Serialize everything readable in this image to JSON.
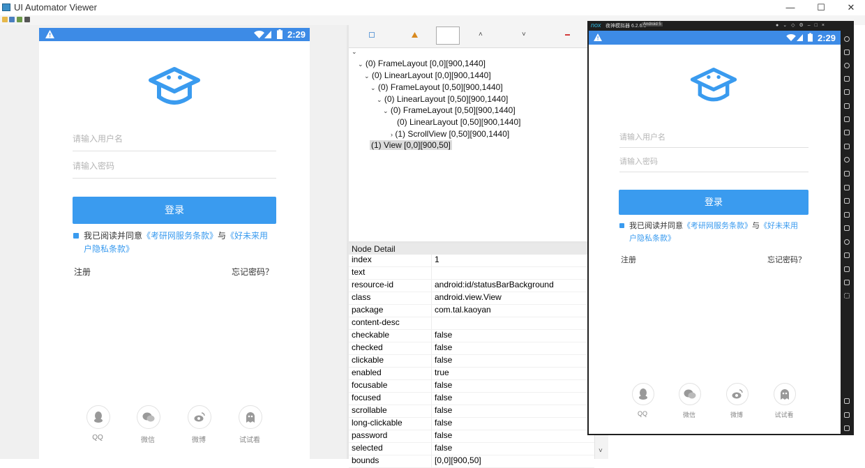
{
  "window": {
    "title": "UI Automator Viewer",
    "controls": {
      "minimize": "—",
      "maximize": "☐",
      "close": "✕"
    }
  },
  "toolbar": {
    "icons": [
      "open-icon",
      "device-screenshot-icon",
      "compressed-screenshot-icon",
      "save-icon"
    ]
  },
  "device_left": {
    "status_time": "2:29",
    "username_placeholder": "请输入用户名",
    "password_placeholder": "请输入密码",
    "login_label": "登录",
    "agree_prefix": "我已阅读并同意",
    "agree_link1": "《考研网服务条款》",
    "agree_and": "与",
    "agree_link2_line1": "《好未来用",
    "agree_link2_line2": "户隐私条款》",
    "register": "注册",
    "forgot": "忘记密码？",
    "social": [
      {
        "label": "QQ",
        "icon": "qq-icon"
      },
      {
        "label": "微信",
        "icon": "wechat-icon"
      },
      {
        "label": "微博",
        "icon": "weibo-icon"
      },
      {
        "label": "试试看",
        "icon": "ghost-icon"
      }
    ]
  },
  "tree_toolbar": {
    "icons": [
      "expand-all-icon",
      "warning-icon",
      "filter-icon",
      "up-icon",
      "down-icon",
      "collapse-icon"
    ]
  },
  "tree": {
    "root_chevron": "⌄",
    "nodes": [
      {
        "text": "(0) FrameLayout [0,0][900,1440]",
        "chev": "⌄"
      },
      {
        "text": "(0) LinearLayout [0,0][900,1440]",
        "chev": "⌄"
      },
      {
        "text": "(0) FrameLayout [0,50][900,1440]",
        "chev": "⌄"
      },
      {
        "text": "(0) LinearLayout [0,50][900,1440]",
        "chev": "⌄"
      },
      {
        "text": "(0) FrameLayout [0,50][900,1440]",
        "chev": "⌄"
      },
      {
        "text": "(0) LinearLayout [0,50][900,1440]",
        "chev": ""
      },
      {
        "text": "(1) ScrollView [0,50][900,1440]",
        "chev": "›"
      },
      {
        "text": "(1) View [0,0][900,50]",
        "chev": ""
      }
    ]
  },
  "node_detail": {
    "title": "Node Detail",
    "rows": [
      {
        "key": "index",
        "value": "1"
      },
      {
        "key": "text",
        "value": ""
      },
      {
        "key": "resource-id",
        "value": "android:id/statusBarBackground"
      },
      {
        "key": "class",
        "value": "android.view.View"
      },
      {
        "key": "package",
        "value": "com.tal.kaoyan"
      },
      {
        "key": "content-desc",
        "value": ""
      },
      {
        "key": "checkable",
        "value": "false"
      },
      {
        "key": "checked",
        "value": "false"
      },
      {
        "key": "clickable",
        "value": "false"
      },
      {
        "key": "enabled",
        "value": "true"
      },
      {
        "key": "focusable",
        "value": "false"
      },
      {
        "key": "focused",
        "value": "false"
      },
      {
        "key": "scrollable",
        "value": "false"
      },
      {
        "key": "long-clickable",
        "value": "false"
      },
      {
        "key": "password",
        "value": "false"
      },
      {
        "key": "selected",
        "value": "false"
      },
      {
        "key": "bounds",
        "value": "[0,0][900,50]"
      }
    ]
  },
  "nox": {
    "logo": "nox",
    "title": "夜神模拟器 6.2.6.0",
    "badge": "Android 5",
    "status_time": "2:29",
    "username_placeholder": "请输入用户名",
    "password_placeholder": "请输入密码",
    "login_label": "登录",
    "agree_prefix": "我已阅读并同意",
    "agree_link1": "《考研网服务条款》",
    "agree_and": "与",
    "agree_link2_line1": "《好未来用",
    "agree_link2_line2": "户隐私条款》",
    "register": "注册",
    "forgot": "忘记密码？",
    "social": [
      {
        "label": "QQ",
        "icon": "qq-icon"
      },
      {
        "label": "微信",
        "icon": "wechat-icon"
      },
      {
        "label": "微博",
        "icon": "weibo-icon"
      },
      {
        "label": "试试看",
        "icon": "ghost-icon"
      }
    ]
  },
  "colors": {
    "accent": "#3a9bef",
    "statusbar": "#3d8be6",
    "nox_frame": "#1f1f1f"
  }
}
